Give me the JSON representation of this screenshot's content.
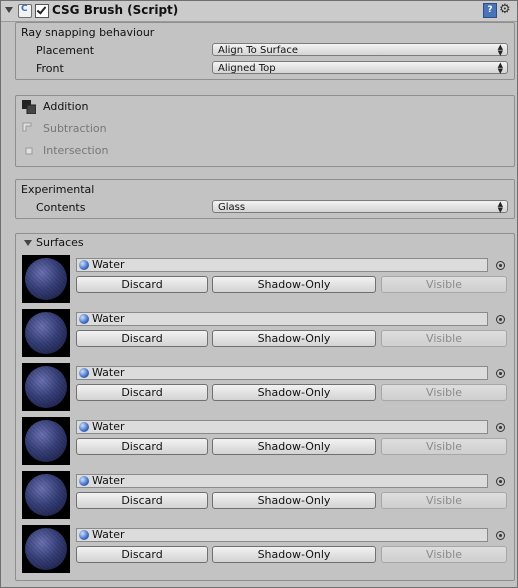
{
  "component": {
    "title": "CSG Brush (Script)"
  },
  "ray_snapping": {
    "heading": "Ray snapping behaviour",
    "placement_label": "Placement",
    "placement_value": "Align To Surface",
    "front_label": "Front",
    "front_value": "Aligned Top"
  },
  "operations": {
    "addition": "Addition",
    "subtraction": "Subtraction",
    "intersection": "Intersection"
  },
  "experimental": {
    "heading": "Experimental",
    "contents_label": "Contents",
    "contents_value": "Glass"
  },
  "surfaces": {
    "heading": "Surfaces",
    "items": [
      {
        "material": "Water",
        "discard": "Discard",
        "shadow": "Shadow-Only",
        "visible": "Visible"
      },
      {
        "material": "Water",
        "discard": "Discard",
        "shadow": "Shadow-Only",
        "visible": "Visible"
      },
      {
        "material": "Water",
        "discard": "Discard",
        "shadow": "Shadow-Only",
        "visible": "Visible"
      },
      {
        "material": "Water",
        "discard": "Discard",
        "shadow": "Shadow-Only",
        "visible": "Visible"
      },
      {
        "material": "Water",
        "discard": "Discard",
        "shadow": "Shadow-Only",
        "visible": "Visible"
      },
      {
        "material": "Water",
        "discard": "Discard",
        "shadow": "Shadow-Only",
        "visible": "Visible"
      }
    ]
  },
  "icons": {
    "foldout": "triangle-down-icon",
    "script": "script-icon",
    "help": "help-icon",
    "settings": "gear-icon",
    "material": "material-sphere-icon",
    "picker": "object-picker-icon"
  }
}
